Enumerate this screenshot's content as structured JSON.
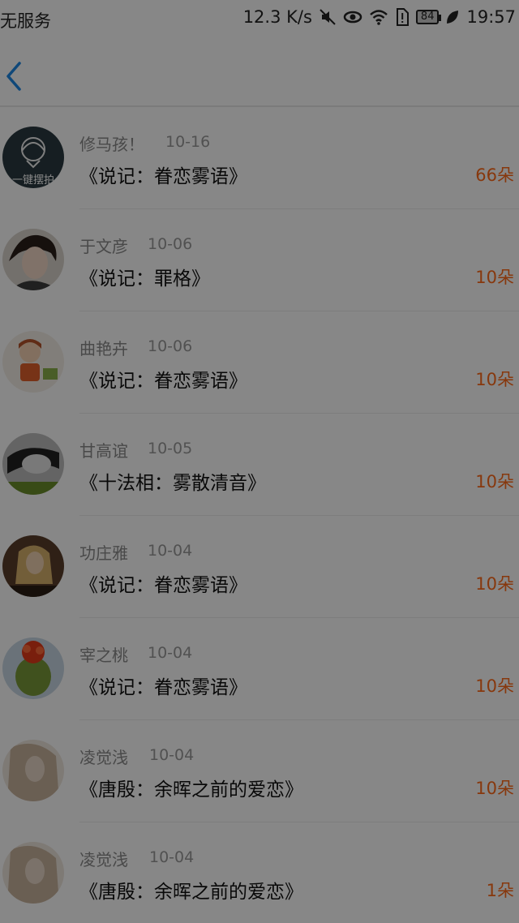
{
  "status_bar": {
    "carrier": "无服务",
    "network_speed": "12.3 K/s",
    "battery": "84",
    "time": "19:57",
    "icons": [
      "mute-icon",
      "eye-icon",
      "wifi-icon",
      "sim-alert-icon",
      "battery-icon",
      "leaf-icon"
    ]
  },
  "header": {
    "back_icon": "chevron-left-icon",
    "accent_color": "#1e88e5"
  },
  "colors": {
    "count": "#ff6a1a",
    "name": "#8a8a8a",
    "title": "#111111"
  },
  "items": [
    {
      "name": "修马孩！",
      "date": "10-16",
      "title": "《说记：眷恋雾语》",
      "count": "66朵",
      "avatar_text": "一键摆拍"
    },
    {
      "name": "于文彦",
      "date": "10-06",
      "title": "《说记：罪格》",
      "count": "10朵"
    },
    {
      "name": "曲艳卉",
      "date": "10-06",
      "title": "《说记：眷恋雾语》",
      "count": "10朵"
    },
    {
      "name": "甘高谊",
      "date": "10-05",
      "title": "《十法相：雾散清音》",
      "count": "10朵"
    },
    {
      "name": "功庄雅",
      "date": "10-04",
      "title": "《说记：眷恋雾语》",
      "count": "10朵"
    },
    {
      "name": "宰之桃",
      "date": "10-04",
      "title": "《说记：眷恋雾语》",
      "count": "10朵"
    },
    {
      "name": "凌觉浅",
      "date": "10-04",
      "title": "《唐殷：余晖之前的爱恋》",
      "count": "10朵"
    },
    {
      "name": "凌觉浅",
      "date": "10-04",
      "title": "《唐殷：余晖之前的爱恋》",
      "count": "1朵"
    }
  ]
}
